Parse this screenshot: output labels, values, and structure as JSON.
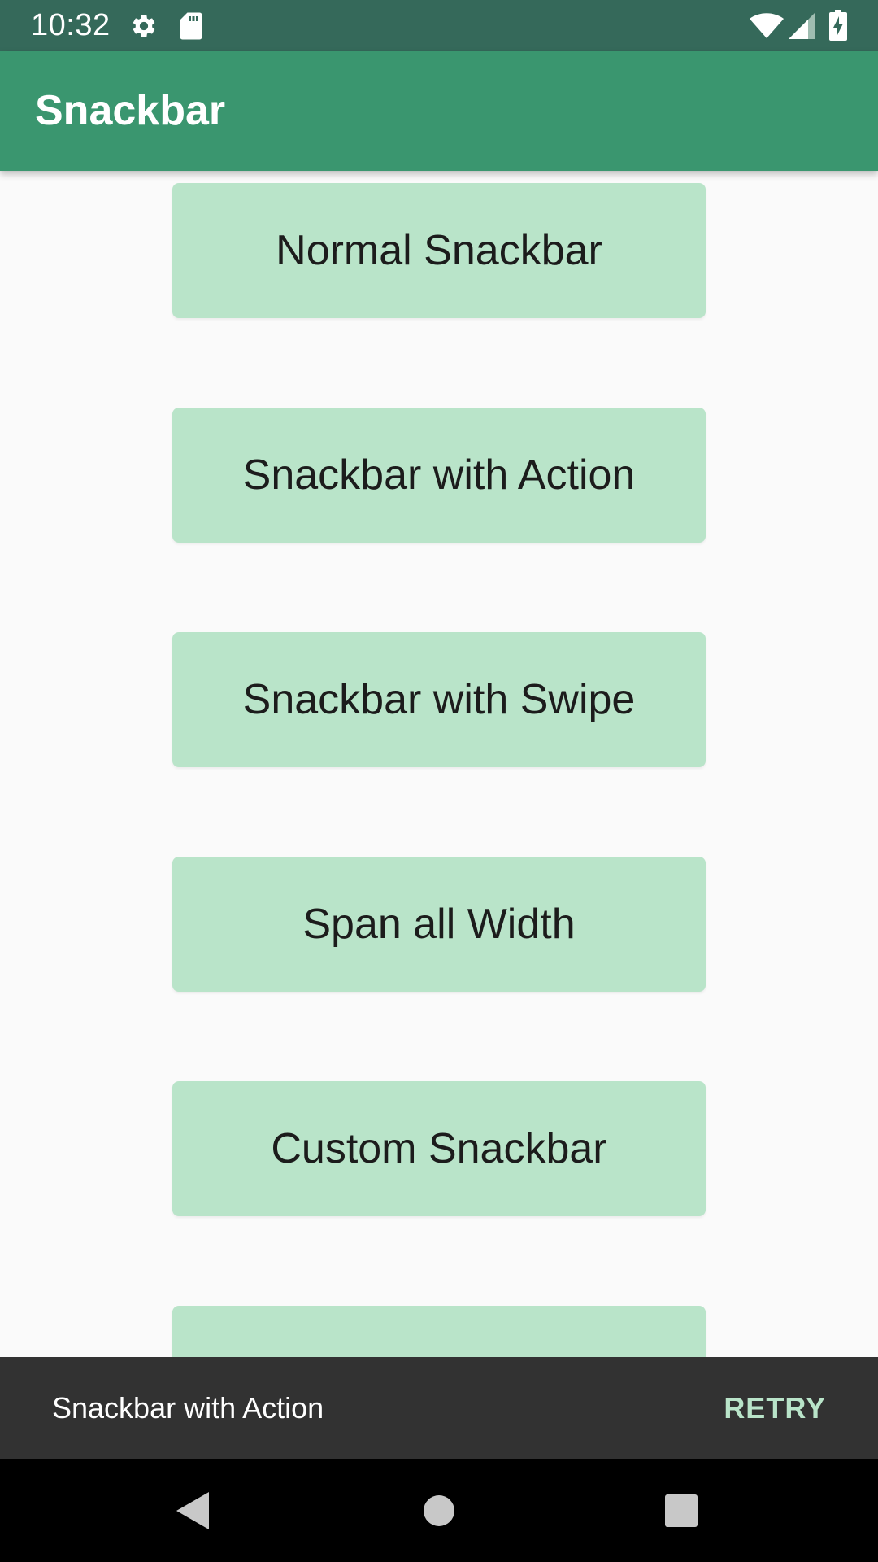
{
  "status_bar": {
    "time": "10:32",
    "icons": [
      "gear-icon",
      "sd-card-icon",
      "wifi-icon",
      "cell-signal-icon",
      "battery-charging-icon"
    ]
  },
  "app_bar": {
    "title": "Snackbar"
  },
  "buttons": [
    {
      "label": "Normal Snackbar"
    },
    {
      "label": "Snackbar with Action"
    },
    {
      "label": "Snackbar with Swipe"
    },
    {
      "label": "Span all Width"
    },
    {
      "label": "Custom Snackbar"
    },
    {
      "label": ""
    }
  ],
  "snackbar": {
    "message": "Snackbar with Action",
    "action": "RETRY"
  },
  "nav_bar": {
    "icons": [
      "back-icon",
      "home-icon",
      "recents-icon"
    ]
  },
  "colors": {
    "status_bar": "#35695a",
    "app_bar": "#3a966f",
    "button_bg": "#b9e4c9",
    "snackbar_bg": "#323232",
    "snackbar_action": "#b9e4c9"
  }
}
